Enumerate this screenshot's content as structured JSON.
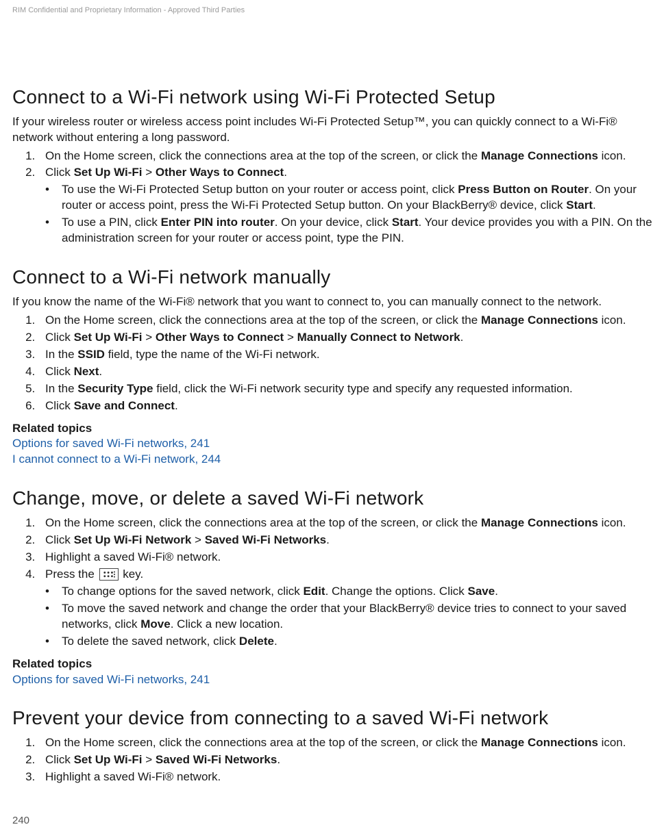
{
  "header": {
    "confidential": "RIM Confidential and Proprietary Information - Approved Third Parties"
  },
  "sections": {
    "s1": {
      "title": "Connect to a Wi-Fi network using Wi-Fi Protected Setup",
      "intro": "If your wireless router or wireless access point includes Wi-Fi Protected Setup™, you can quickly connect to a Wi-Fi® network without entering a long password.",
      "step1_a": "On the Home screen, click the connections area at the top of the screen, or click the ",
      "step1_b": "Manage Connections",
      "step1_c": " icon.",
      "step2_a": "Click ",
      "step2_b": "Set Up Wi-Fi",
      "step2_c": " > ",
      "step2_d": "Other Ways to Connect",
      "step2_e": ".",
      "bullet1_a": "To use the Wi-Fi Protected Setup button on your router or access point, click ",
      "bullet1_b": "Press Button on Router",
      "bullet1_c": ". On your router or access point, press the Wi-Fi Protected Setup button. On your BlackBerry® device, click ",
      "bullet1_d": "Start",
      "bullet1_e": ".",
      "bullet2_a": "To use a PIN, click ",
      "bullet2_b": "Enter PIN into router",
      "bullet2_c": ". On your device, click ",
      "bullet2_d": "Start",
      "bullet2_e": ". Your device provides you with a PIN. On the administration screen for your router or access point, type the PIN."
    },
    "s2": {
      "title": "Connect to a Wi-Fi network manually",
      "intro": "If you know the name of the Wi-Fi® network that you want to connect to, you can manually connect to the network.",
      "step1_a": "On the Home screen, click the connections area at the top of the screen, or click the ",
      "step1_b": "Manage Connections",
      "step1_c": " icon.",
      "step2_a": "Click ",
      "step2_b": "Set Up Wi-Fi",
      "step2_c": " > ",
      "step2_d": "Other Ways to Connect",
      "step2_e": " > ",
      "step2_f": "Manually Connect to Network",
      "step2_g": ".",
      "step3_a": "In the ",
      "step3_b": "SSID",
      "step3_c": " field, type the name of the Wi-Fi network.",
      "step4_a": "Click ",
      "step4_b": "Next",
      "step4_c": ".",
      "step5_a": "In the ",
      "step5_b": "Security Type",
      "step5_c": " field, click the Wi-Fi network security type and specify any requested information.",
      "step6_a": "Click ",
      "step6_b": "Save and Connect",
      "step6_c": ".",
      "related_heading": "Related topics",
      "related1": "Options for saved Wi-Fi networks, 241",
      "related2": "I cannot connect to a Wi-Fi network, 244"
    },
    "s3": {
      "title": "Change, move, or delete a saved Wi-Fi network",
      "step1_a": "On the Home screen, click the connections area at the top of the screen, or click the ",
      "step1_b": "Manage Connections",
      "step1_c": " icon.",
      "step2_a": "Click ",
      "step2_b": "Set Up Wi-Fi Network",
      "step2_c": " > ",
      "step2_d": "Saved Wi-Fi Networks",
      "step2_e": ".",
      "step3": "Highlight a saved Wi-Fi® network.",
      "step4_a": "Press the ",
      "step4_b": " key.",
      "bullet1_a": "To change options for the saved network, click ",
      "bullet1_b": "Edit",
      "bullet1_c": ". Change the options. Click ",
      "bullet1_d": "Save",
      "bullet1_e": ".",
      "bullet2_a": "To move the saved network and change the order that your BlackBerry® device tries to connect to your saved networks, click ",
      "bullet2_b": "Move",
      "bullet2_c": ". Click a new location.",
      "bullet3_a": "To delete the saved network, click ",
      "bullet3_b": "Delete",
      "bullet3_c": ".",
      "related_heading": "Related topics",
      "related1": "Options for saved Wi-Fi networks, 241"
    },
    "s4": {
      "title": "Prevent your device from connecting to a saved Wi-Fi network",
      "step1_a": "On the Home screen, click the connections area at the top of the screen, or click the ",
      "step1_b": "Manage Connections",
      "step1_c": " icon.",
      "step2_a": "Click ",
      "step2_b": "Set Up Wi-Fi",
      "step2_c": " > ",
      "step2_d": "Saved Wi-Fi Networks",
      "step2_e": ".",
      "step3": "Highlight a saved Wi-Fi® network."
    }
  },
  "footer": {
    "page_number": "240"
  }
}
